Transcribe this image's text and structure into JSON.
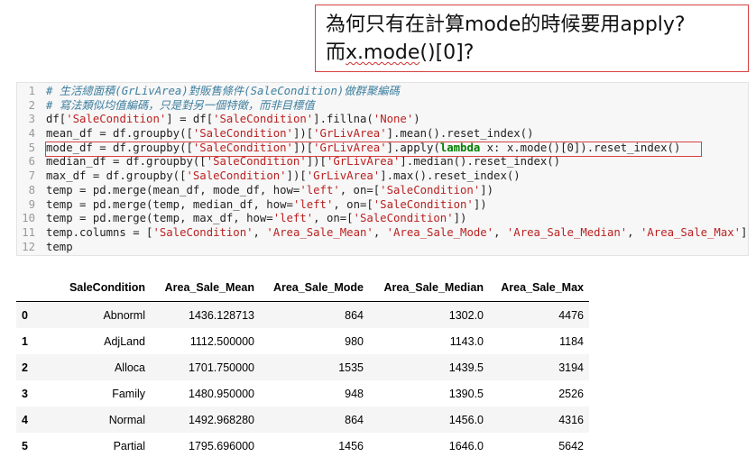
{
  "callout": {
    "line1": "為何只有在計算mode的時候要用apply?",
    "line2_prefix": "而",
    "line2_code": "x.mode",
    "line2_suffix": "()[0]?"
  },
  "code": {
    "lines": [
      {
        "n": "1"
      },
      {
        "n": "2"
      },
      {
        "n": "3"
      },
      {
        "n": "4"
      },
      {
        "n": "5"
      },
      {
        "n": "6"
      },
      {
        "n": "7"
      },
      {
        "n": "8"
      },
      {
        "n": "9"
      },
      {
        "n": "10"
      },
      {
        "n": "11"
      },
      {
        "n": "12"
      }
    ],
    "l1": "# 生活總面積(GrLivArea)對販售條件(SaleCondition)做群聚編碼",
    "l2": "# 寫法類似均值編碼，只是對另一個特徵，而非目標值",
    "l3": [
      "df[",
      "'SaleCondition'",
      "] = df[",
      "'SaleCondition'",
      "].fillna(",
      "'None'",
      ")"
    ],
    "l4": [
      "mean_df = df.groupby([",
      "'SaleCondition'",
      "])[",
      "'GrLivArea'",
      "].mean().reset_index()"
    ],
    "l5": [
      "mode_df = df.groupby([",
      "'SaleCondition'",
      "])[",
      "'GrLivArea'",
      "].apply(",
      "lambda",
      " x: x.mode()[0]).reset_index()"
    ],
    "l6": [
      "median_df = df.groupby([",
      "'SaleCondition'",
      "])[",
      "'GrLivArea'",
      "].median().reset_index()"
    ],
    "l7": [
      "max_df = df.groupby([",
      "'SaleCondition'",
      "])[",
      "'GrLivArea'",
      "].max().reset_index()"
    ],
    "l8": [
      "temp = pd.merge(mean_df, mode_df, how=",
      "'left'",
      ", on=[",
      "'SaleCondition'",
      "])"
    ],
    "l9": [
      "temp = pd.merge(temp, median_df, how=",
      "'left'",
      ", on=[",
      "'SaleCondition'",
      "])"
    ],
    "l10": [
      "temp = pd.merge(temp, max_df, how=",
      "'left'",
      ", on=[",
      "'SaleCondition'",
      "])"
    ],
    "l11": [
      "temp.columns = [",
      "'SaleCondition'",
      ", ",
      "'Area_Sale_Mean'",
      ", ",
      "'Area_Sale_Mode'",
      ", ",
      "'Area_Sale_Median'",
      ", ",
      "'Area_Sale_Max'",
      "]"
    ],
    "l12": "temp"
  },
  "table": {
    "headers": [
      "",
      "SaleCondition",
      "Area_Sale_Mean",
      "Area_Sale_Mode",
      "Area_Sale_Median",
      "Area_Sale_Max"
    ],
    "rows": [
      {
        "idx": "0",
        "cond": "Abnorml",
        "mean": "1436.128713",
        "mode": "864",
        "median": "1302.0",
        "max": "4476"
      },
      {
        "idx": "1",
        "cond": "AdjLand",
        "mean": "1112.500000",
        "mode": "980",
        "median": "1143.0",
        "max": "1184"
      },
      {
        "idx": "2",
        "cond": "Alloca",
        "mean": "1701.750000",
        "mode": "1535",
        "median": "1439.5",
        "max": "3194"
      },
      {
        "idx": "3",
        "cond": "Family",
        "mean": "1480.950000",
        "mode": "948",
        "median": "1390.5",
        "max": "2526"
      },
      {
        "idx": "4",
        "cond": "Normal",
        "mean": "1492.968280",
        "mode": "864",
        "median": "1456.0",
        "max": "4316"
      },
      {
        "idx": "5",
        "cond": "Partial",
        "mean": "1795.696000",
        "mode": "1456",
        "median": "1646.0",
        "max": "5642"
      }
    ]
  }
}
